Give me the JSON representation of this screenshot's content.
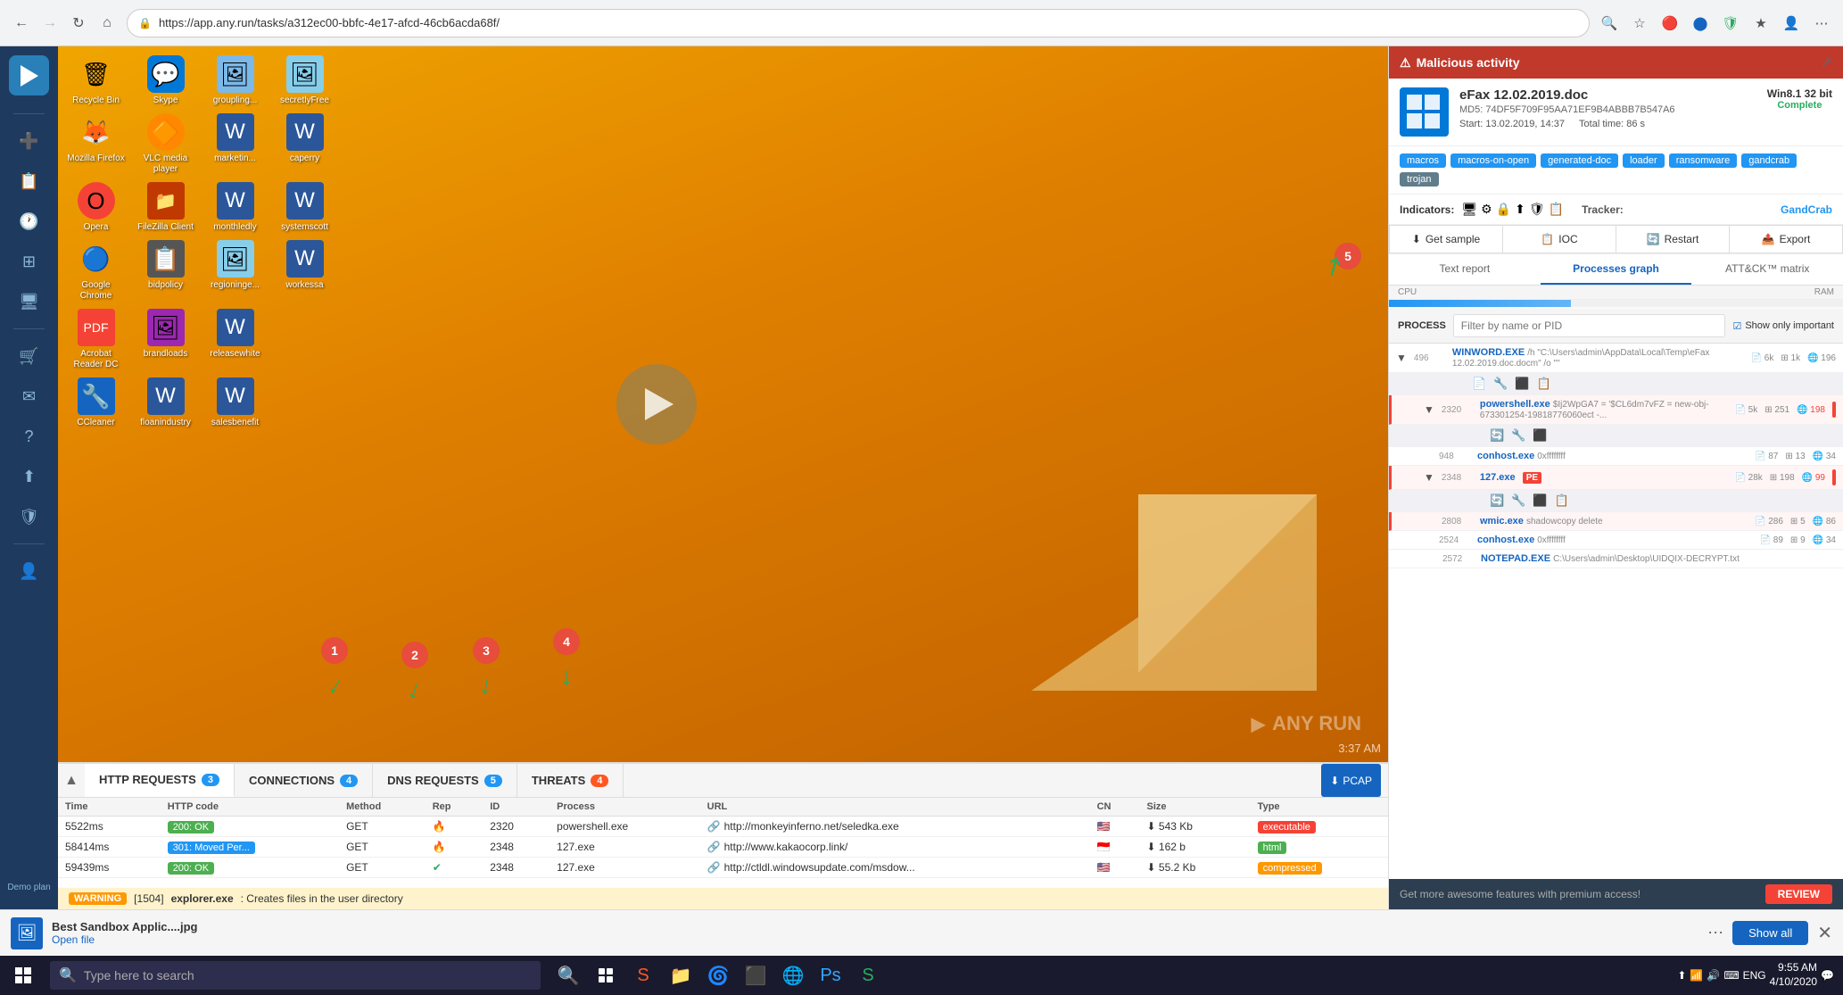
{
  "browser": {
    "url": "https://app.any.run/tasks/a312ec00-bbfc-4e17-afcd-46cb6acda68f/",
    "back_disabled": false,
    "forward_disabled": true
  },
  "malware_info": {
    "header_label": "Malicious activity",
    "file_name": "eFax 12.02.2019.doc",
    "md5": "MD5: 74DF5F709F95AA71EF9B4ABBB7B547A6",
    "start": "Start: 13.02.2019, 14:37",
    "total_time": "Total time: 86 s",
    "os": "Win8.1 32 bit",
    "status": "Complete",
    "tracker": "GandCrab",
    "tracker_label": "Tracker:",
    "indicators_label": "Indicators:",
    "tags": [
      "macros",
      "macros-on-open",
      "generated-doc",
      "loader",
      "ransomware",
      "gandcrab",
      "trojan"
    ],
    "actions": {
      "get_sample": "Get sample",
      "ioc": "IOC",
      "restart": "Restart",
      "export": "Export"
    },
    "views": {
      "text_report": "Text report",
      "processes_graph": "Processes graph",
      "attck_matrix": "ATT&CK™ matrix"
    }
  },
  "process_section": {
    "label": "PROCESS",
    "search_placeholder": "Filter by name or PID",
    "show_important_label": "Show only important",
    "processes": [
      {
        "id": "496",
        "name": "WINWORD.EXE",
        "args": "/h \"C:\\Users\\admin\\AppData\\Local\\Temp\\eFax 12.02.2019.doc.docm\" /o \"\"",
        "files": "6k",
        "registry": "1k",
        "network": "196",
        "expanded": true,
        "type": "normal"
      },
      {
        "id": "2320",
        "name": "powershell.exe",
        "args": "$Ij2WpGA7 = '$CL6dm7vFZ = new-obj-673301254-19818776060ect -...",
        "files": "5k",
        "registry": "251",
        "network": "198",
        "expanded": true,
        "type": "malicious",
        "indent": 1
      },
      {
        "id": "948",
        "name": "conhost.exe",
        "args": "0xffffffff",
        "files": "87",
        "registry": "13",
        "network": "34",
        "type": "normal",
        "indent": 2
      },
      {
        "id": "2348",
        "name": "127.exe",
        "tag": "PE",
        "files": "28k",
        "registry": "198",
        "network": "99",
        "expanded": true,
        "type": "malicious",
        "indent": 1
      },
      {
        "id": "2808",
        "name": "wmic.exe",
        "args": "shadowcopy delete",
        "files": "286",
        "registry": "5",
        "network": "86",
        "type": "malicious",
        "indent": 2
      },
      {
        "id": "2524",
        "name": "conhost.exe",
        "args": "0xffffffff",
        "files": "89",
        "registry": "9",
        "network": "34",
        "type": "normal",
        "indent": 2
      },
      {
        "id": "2572",
        "name": "NOTEPAD.EXE",
        "args": "C:\\Users\\admin\\Desktop\\UIDQIX-DECRYPT.txt",
        "files": "",
        "registry": "",
        "network": "",
        "type": "normal",
        "indent": 1
      }
    ]
  },
  "bottom_panel": {
    "tabs": [
      {
        "label": "HTTP REQUESTS",
        "count": "3",
        "active": true
      },
      {
        "label": "CONNECTIONS",
        "count": "4",
        "active": false
      },
      {
        "label": "DNS REQUESTS",
        "count": "5",
        "active": false
      },
      {
        "label": "THREATS",
        "count": "4",
        "active": false
      }
    ],
    "pcap_label": "PCAP",
    "columns": [
      "Time",
      "HTTP code",
      "Method",
      "Rep",
      "ID",
      "Process",
      "URL",
      "CN",
      "Size",
      "Type"
    ],
    "rows": [
      {
        "time": "5522ms",
        "http_code": "200: OK",
        "http_class": "http-200",
        "method": "GET",
        "id": "2320",
        "process": "powershell.exe",
        "url": "http://monkeyinferno.net/seledka.exe",
        "cn": "🇺🇸",
        "size": "543 Kb",
        "type": "executable",
        "type_class": "type-executable"
      },
      {
        "time": "58414ms",
        "http_code": "301: Moved Per...",
        "http_class": "http-301",
        "method": "GET",
        "id": "2348",
        "process": "127.exe",
        "url": "http://www.kakaocorp.link/",
        "cn": "🇮🇩",
        "size": "162 b",
        "type": "html",
        "type_class": "type-html"
      },
      {
        "time": "59439ms",
        "http_code": "200: OK",
        "http_class": "http-200",
        "method": "GET",
        "id": "2348",
        "process": "127.exe",
        "url": "http://ctldl.windowsupdate.com/msdow...",
        "cn": "🇺🇸",
        "size": "55.2 Kb",
        "type": "compressed",
        "type_class": "type-compressed"
      }
    ]
  },
  "warning_bar": {
    "level": "WARNING",
    "pid": "1504",
    "process": "explorer.exe",
    "message": "Creates files in the user directory"
  },
  "premium_bar": {
    "message": "Get more awesome features with premium access!",
    "review_btn": "REVIEW"
  },
  "download_bar": {
    "file_name": "Best Sandbox Applic....jpg",
    "open_link": "Open file",
    "show_all": "Show all"
  },
  "taskbar": {
    "search_placeholder": "Type here to search",
    "time": "9:55 AM",
    "date": "4/10/2020",
    "language": "ENG"
  },
  "sandbox": {
    "annotations": [
      {
        "number": "1",
        "label": ""
      },
      {
        "number": "2",
        "label": ""
      },
      {
        "number": "3",
        "label": ""
      },
      {
        "number": "4",
        "label": ""
      },
      {
        "number": "5",
        "label": ""
      }
    ],
    "timestamp": "3:37 AM",
    "watermark": "ANY RUN"
  },
  "desktop_icons": [
    {
      "name": "Recycle Bin",
      "icon": "🗑"
    },
    {
      "name": "Skype",
      "icon": "💬"
    },
    {
      "name": "groupling...",
      "icon": "🖼"
    },
    {
      "name": "secretlyFree",
      "icon": "🖼"
    },
    {
      "name": "Mozilla Firefox",
      "icon": "🦊"
    },
    {
      "name": "VLC media player",
      "icon": "🔶"
    },
    {
      "name": "marketin...",
      "icon": "📄"
    },
    {
      "name": "caperry",
      "icon": "📄"
    },
    {
      "name": "Opera",
      "icon": "🔴"
    },
    {
      "name": "FileZilla Client",
      "icon": "📁"
    },
    {
      "name": "monthledly",
      "icon": "📄"
    },
    {
      "name": "systemscott",
      "icon": "📄"
    },
    {
      "name": "Google Chrome",
      "icon": "🔵"
    },
    {
      "name": "bidpolicy",
      "icon": "📋"
    },
    {
      "name": "regioninge...",
      "icon": "🖼"
    },
    {
      "name": "workessa",
      "icon": "📄"
    },
    {
      "name": "Acrobat Reader DC",
      "icon": "📕"
    },
    {
      "name": "brandloads",
      "icon": "🖼"
    },
    {
      "name": "releasewhite",
      "icon": "📄"
    },
    {
      "name": "CCleaner",
      "icon": "🧹"
    },
    {
      "name": "floanindustry",
      "icon": "📄"
    },
    {
      "name": "salesbenefit",
      "icon": "📄"
    }
  ],
  "sidebar_icons": [
    {
      "name": "plus-icon",
      "symbol": "+",
      "active": false
    },
    {
      "name": "document-icon",
      "symbol": "📄",
      "active": false
    },
    {
      "name": "history-icon",
      "symbol": "🕐",
      "active": false
    },
    {
      "name": "grid-icon",
      "symbol": "⊞",
      "active": false
    },
    {
      "name": "window-icon",
      "symbol": "🖥",
      "active": false
    },
    {
      "name": "cart-icon",
      "symbol": "🛒",
      "active": false
    },
    {
      "name": "mail-icon",
      "symbol": "✉",
      "active": false
    },
    {
      "name": "question-icon",
      "symbol": "?",
      "active": false
    },
    {
      "name": "upload-icon",
      "symbol": "⬆",
      "active": false
    },
    {
      "name": "shield-icon",
      "symbol": "🛡",
      "active": false
    },
    {
      "name": "user-icon",
      "symbol": "👤",
      "active": false
    },
    {
      "name": "demo-label",
      "symbol": "Demo plan",
      "active": false
    }
  ]
}
